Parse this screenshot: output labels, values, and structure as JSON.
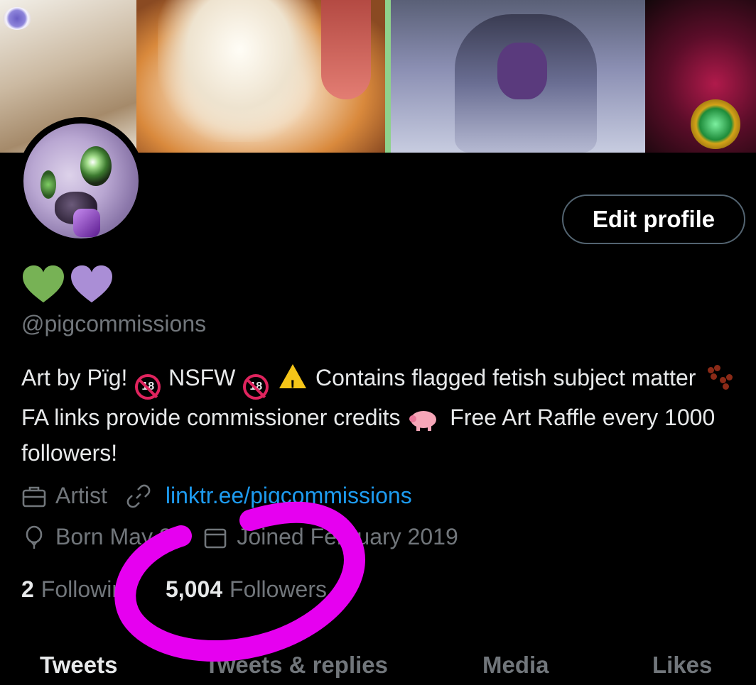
{
  "profile": {
    "edit_button": "Edit profile",
    "hearts": [
      "#77b255",
      "#aa8ed6"
    ],
    "handle": "@pigcommissions",
    "bio": {
      "part1": "Art by Pïg!",
      "part2": "NSFW",
      "part3": "Contains flagged fetish subject matter",
      "part4": "FA links provide commissioner credits",
      "part5": "Free Art Raffle every 1000 followers!",
      "age_badge": "18"
    },
    "category": "Artist",
    "link": "linktr.ee/pigcommissions",
    "birthday": "Born May 27",
    "joined": "Joined February 2019",
    "following_count": "2",
    "following_label": "Following",
    "followers_count": "5,004",
    "followers_label": "Followers"
  },
  "tabs": [
    "Tweets",
    "Tweets & replies",
    "Media",
    "Likes"
  ],
  "colors": {
    "background": "#000000",
    "text_primary": "#e7e9ea",
    "text_secondary": "#71767b",
    "link": "#1d9bf0",
    "annotation": "#e600f0"
  }
}
